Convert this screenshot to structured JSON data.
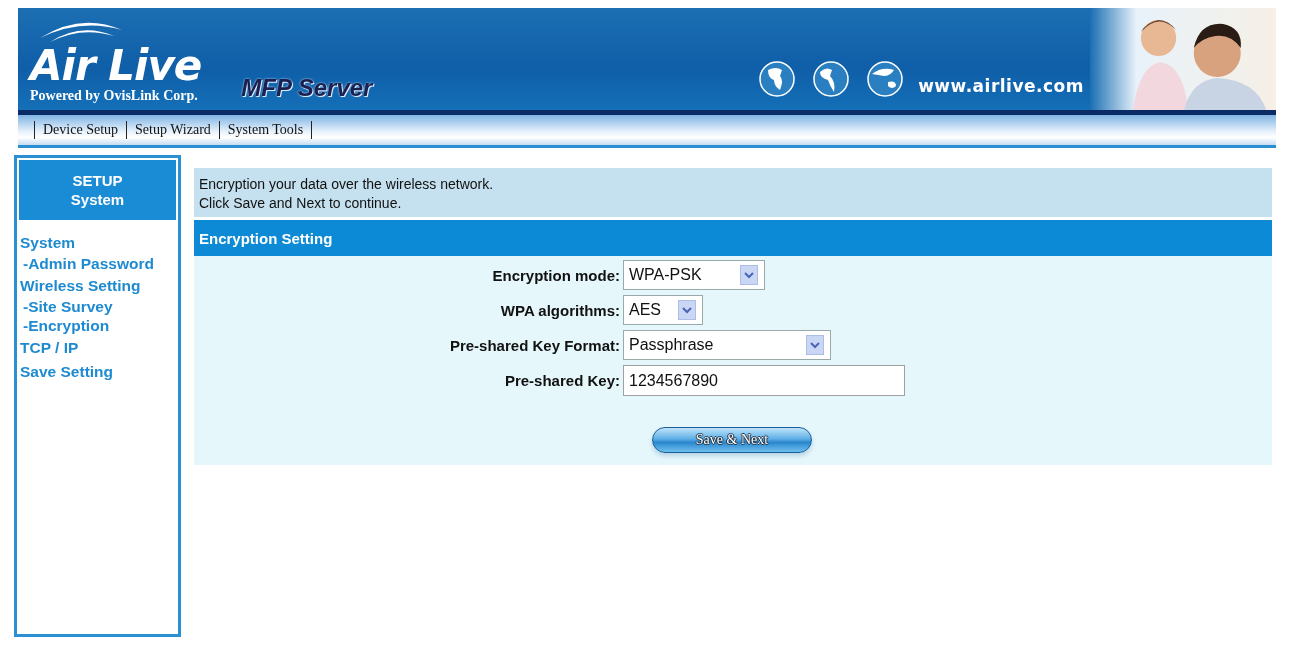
{
  "header": {
    "logo": "Air Live",
    "logo_tagline": "Powered by OvisLink Corp.",
    "product": "MFP Server",
    "website": "www.airlive.com"
  },
  "nav": [
    "Device Setup",
    "Setup Wizard",
    "System Tools"
  ],
  "sidebar": {
    "title": "SETUP",
    "subtitle": "System",
    "items": [
      {
        "label": "System",
        "kind": "section"
      },
      {
        "label": "-Admin Password",
        "kind": "sub"
      },
      {
        "label": "Wireless Setting",
        "kind": "section"
      },
      {
        "label": "-Site Survey",
        "kind": "sub"
      },
      {
        "label": "-Encryption",
        "kind": "sub"
      },
      {
        "label": "TCP / IP",
        "kind": "section"
      },
      {
        "label": "Save Setting",
        "kind": "section"
      }
    ]
  },
  "intro": [
    "Encryption your data over the wireless network.",
    "Click Save and Next to continue."
  ],
  "section_title": "Encryption Setting",
  "fields": [
    {
      "label": "Encryption mode:",
      "kind": "select",
      "value": "WPA-PSK"
    },
    {
      "label": "WPA algorithms:",
      "kind": "select",
      "value": "AES"
    },
    {
      "label": "Pre-shared Key Format:",
      "kind": "select",
      "value": "Passphrase"
    },
    {
      "label": "Pre-shared Key:",
      "kind": "text",
      "value": "1234567890"
    }
  ],
  "button": "Save & Next"
}
